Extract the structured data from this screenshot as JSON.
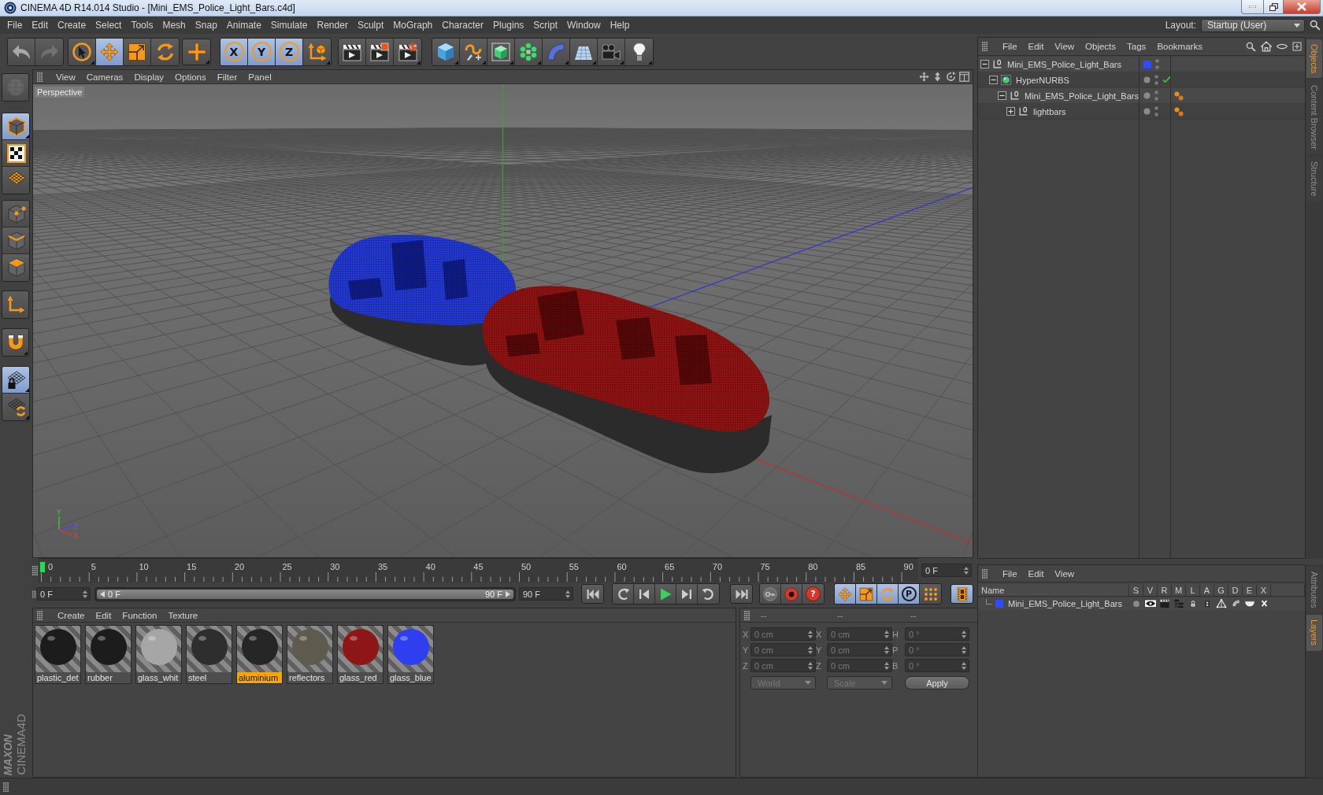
{
  "window": {
    "title": "CINEMA 4D R14.014 Studio - [Mini_EMS_Police_Light_Bars.c4d]"
  },
  "menu_bar": [
    "File",
    "Edit",
    "Create",
    "Select",
    "Tools",
    "Mesh",
    "Snap",
    "Animate",
    "Simulate",
    "Render",
    "Sculpt",
    "MoGraph",
    "Character",
    "Plugins",
    "Script",
    "Window",
    "Help"
  ],
  "layout": {
    "label": "Layout:",
    "value": "Startup (User)"
  },
  "toolbar": [
    {
      "selected": false,
      "disabled": false
    },
    {
      "selected": false,
      "disabled": true
    },
    {
      "selected": false,
      "disabled": false
    },
    {
      "selected": true,
      "disabled": false
    },
    {
      "selected": false,
      "disabled": false
    },
    {
      "selected": false,
      "disabled": false
    },
    {
      "selected": false,
      "disabled": false
    },
    {
      "label": "X",
      "selected": true,
      "disabled": false
    },
    {
      "label": "Y",
      "selected": true,
      "disabled": false
    },
    {
      "label": "Z",
      "selected": true,
      "disabled": false
    },
    {
      "selected": false,
      "disabled": false
    },
    {
      "selected": false,
      "disabled": false
    },
    {
      "selected": false,
      "disabled": false
    },
    {
      "selected": false,
      "disabled": false
    },
    {
      "selected": false,
      "disabled": false
    },
    {
      "selected": false,
      "disabled": false
    },
    {
      "selected": false,
      "disabled": false
    },
    {
      "selected": false,
      "disabled": false
    },
    {
      "selected": false,
      "disabled": false
    },
    {
      "selected": false,
      "disabled": false
    },
    {
      "selected": false,
      "disabled": false
    },
    {
      "selected": false,
      "disabled": false
    }
  ],
  "tool_palette": [
    {
      "selected": false,
      "disabled": true
    },
    {
      "selected": true,
      "disabled": false
    },
    {
      "selected": false,
      "disabled": false
    },
    {
      "selected": false,
      "disabled": false
    },
    {
      "selected": false,
      "disabled": false
    },
    {
      "selected": false,
      "disabled": false
    },
    {
      "selected": false,
      "disabled": false
    },
    {
      "selected": false,
      "disabled": false
    },
    {
      "selected": false,
      "disabled": false
    },
    {
      "selected": true,
      "disabled": false
    },
    {
      "selected": false,
      "disabled": false
    }
  ],
  "viewport": {
    "menu": [
      "View",
      "Cameras",
      "Display",
      "Options",
      "Filter",
      "Panel"
    ],
    "camera": "Perspective",
    "axis_labels": [
      "Y",
      "Z",
      "X"
    ]
  },
  "timeline": {
    "ticks": [
      "0",
      "5",
      "10",
      "15",
      "20",
      "25",
      "30",
      "35",
      "40",
      "45",
      "50",
      "55",
      "60",
      "65",
      "70",
      "75",
      "80",
      "85",
      "90"
    ],
    "level": 0,
    "frame_field": "0 F"
  },
  "transport": {
    "start_field": "0 F",
    "range": {
      "start": "0 F",
      "end": "90 F",
      "level": 1
    },
    "end_field": "90 F",
    "buttons": [
      {
        "selected": false
      },
      {
        "selected": false
      },
      {
        "selected": false
      },
      {
        "selected": false
      },
      {
        "selected": false
      },
      {
        "selected": false
      },
      {
        "selected": false
      },
      {
        "selected": false
      },
      {
        "selected": false
      },
      {
        "label": "?",
        "selected": false
      },
      {
        "selected": true
      },
      {
        "selected": true
      },
      {
        "selected": true
      },
      {
        "label": "P",
        "selected": true
      },
      {
        "selected": false
      },
      {
        "selected": true
      }
    ]
  },
  "material_manager": {
    "menu": [
      "Create",
      "Edit",
      "Function",
      "Texture"
    ],
    "materials": [
      {
        "name": "plastic_det",
        "color": "#1c1c1c",
        "selected": false
      },
      {
        "name": "rubber",
        "color": "#1c1c1c",
        "selected": false
      },
      {
        "name": "glass_whit",
        "color": "#a6a6a6",
        "selected": false
      },
      {
        "name": "steel",
        "color": "#2e2e2e",
        "selected": false
      },
      {
        "name": "aluminium",
        "color": "#262626",
        "selected": true
      },
      {
        "name": "reflectors",
        "color": "#5e5a4e",
        "selected": false
      },
      {
        "name": "glass_red",
        "color": "#8e1616",
        "selected": false
      },
      {
        "name": "glass_blue",
        "color": "#2f3ff0",
        "selected": false
      }
    ]
  },
  "coordinates": {
    "disabled": true,
    "headers": [
      "--",
      "--",
      "--"
    ],
    "rows": [
      [
        {
          "axis": "X",
          "value": "0 cm"
        },
        {
          "axis": "X",
          "value": "0 cm"
        },
        {
          "axis": "H",
          "value": "0 °"
        }
      ],
      [
        {
          "axis": "Y",
          "value": "0 cm"
        },
        {
          "axis": "Y",
          "value": "0 cm"
        },
        {
          "axis": "P",
          "value": "0 °"
        }
      ],
      [
        {
          "axis": "Z",
          "value": "0 cm"
        },
        {
          "axis": "Z",
          "value": "0 cm"
        },
        {
          "axis": "B",
          "value": "0 °"
        }
      ]
    ],
    "dropdowns": [
      "World",
      "Scale"
    ],
    "apply": "Apply"
  },
  "object_manager": {
    "menu": [
      "File",
      "Edit",
      "View",
      "Objects",
      "Tags",
      "Bookmarks"
    ],
    "objects": [
      {
        "kind": "null",
        "name": "Mini_EMS_Police_Light_Bars",
        "expanded": true,
        "color": "#2d4bff",
        "material_tag": false,
        "children": [
          {
            "kind": "hypernurbs",
            "name": "HyperNURBS",
            "expanded": true,
            "enabled": true,
            "material_tag": false,
            "children": [
              {
                "kind": "null",
                "name": "Mini_EMS_Police_Light_Bars",
                "expanded": true,
                "material_tag": true,
                "children": [
                  {
                    "kind": "null",
                    "name": "lightbars",
                    "expanded": false,
                    "material_tag": true
                  }
                ]
              }
            ]
          }
        ]
      }
    ]
  },
  "object_side_tabs": [
    {
      "label": "Objects",
      "selected": true
    },
    {
      "label": "Content Browser",
      "selected": false
    },
    {
      "label": "Structure",
      "selected": false
    }
  ],
  "layer_manager": {
    "menu": [
      "File",
      "Edit",
      "View"
    ],
    "columns": [
      "Name",
      "S",
      "V",
      "R",
      "M",
      "L",
      "A",
      "G",
      "D",
      "E",
      "X"
    ],
    "layers": [
      {
        "name": "Mini_EMS_Police_Light_Bars",
        "color": "#2d4bff"
      }
    ]
  },
  "layer_side_tabs": [
    {
      "label": "Attributes",
      "selected": false
    },
    {
      "label": "Layers",
      "selected": true
    }
  ],
  "logo": {
    "brand": "MAXON",
    "product": "CINEMA4D"
  }
}
